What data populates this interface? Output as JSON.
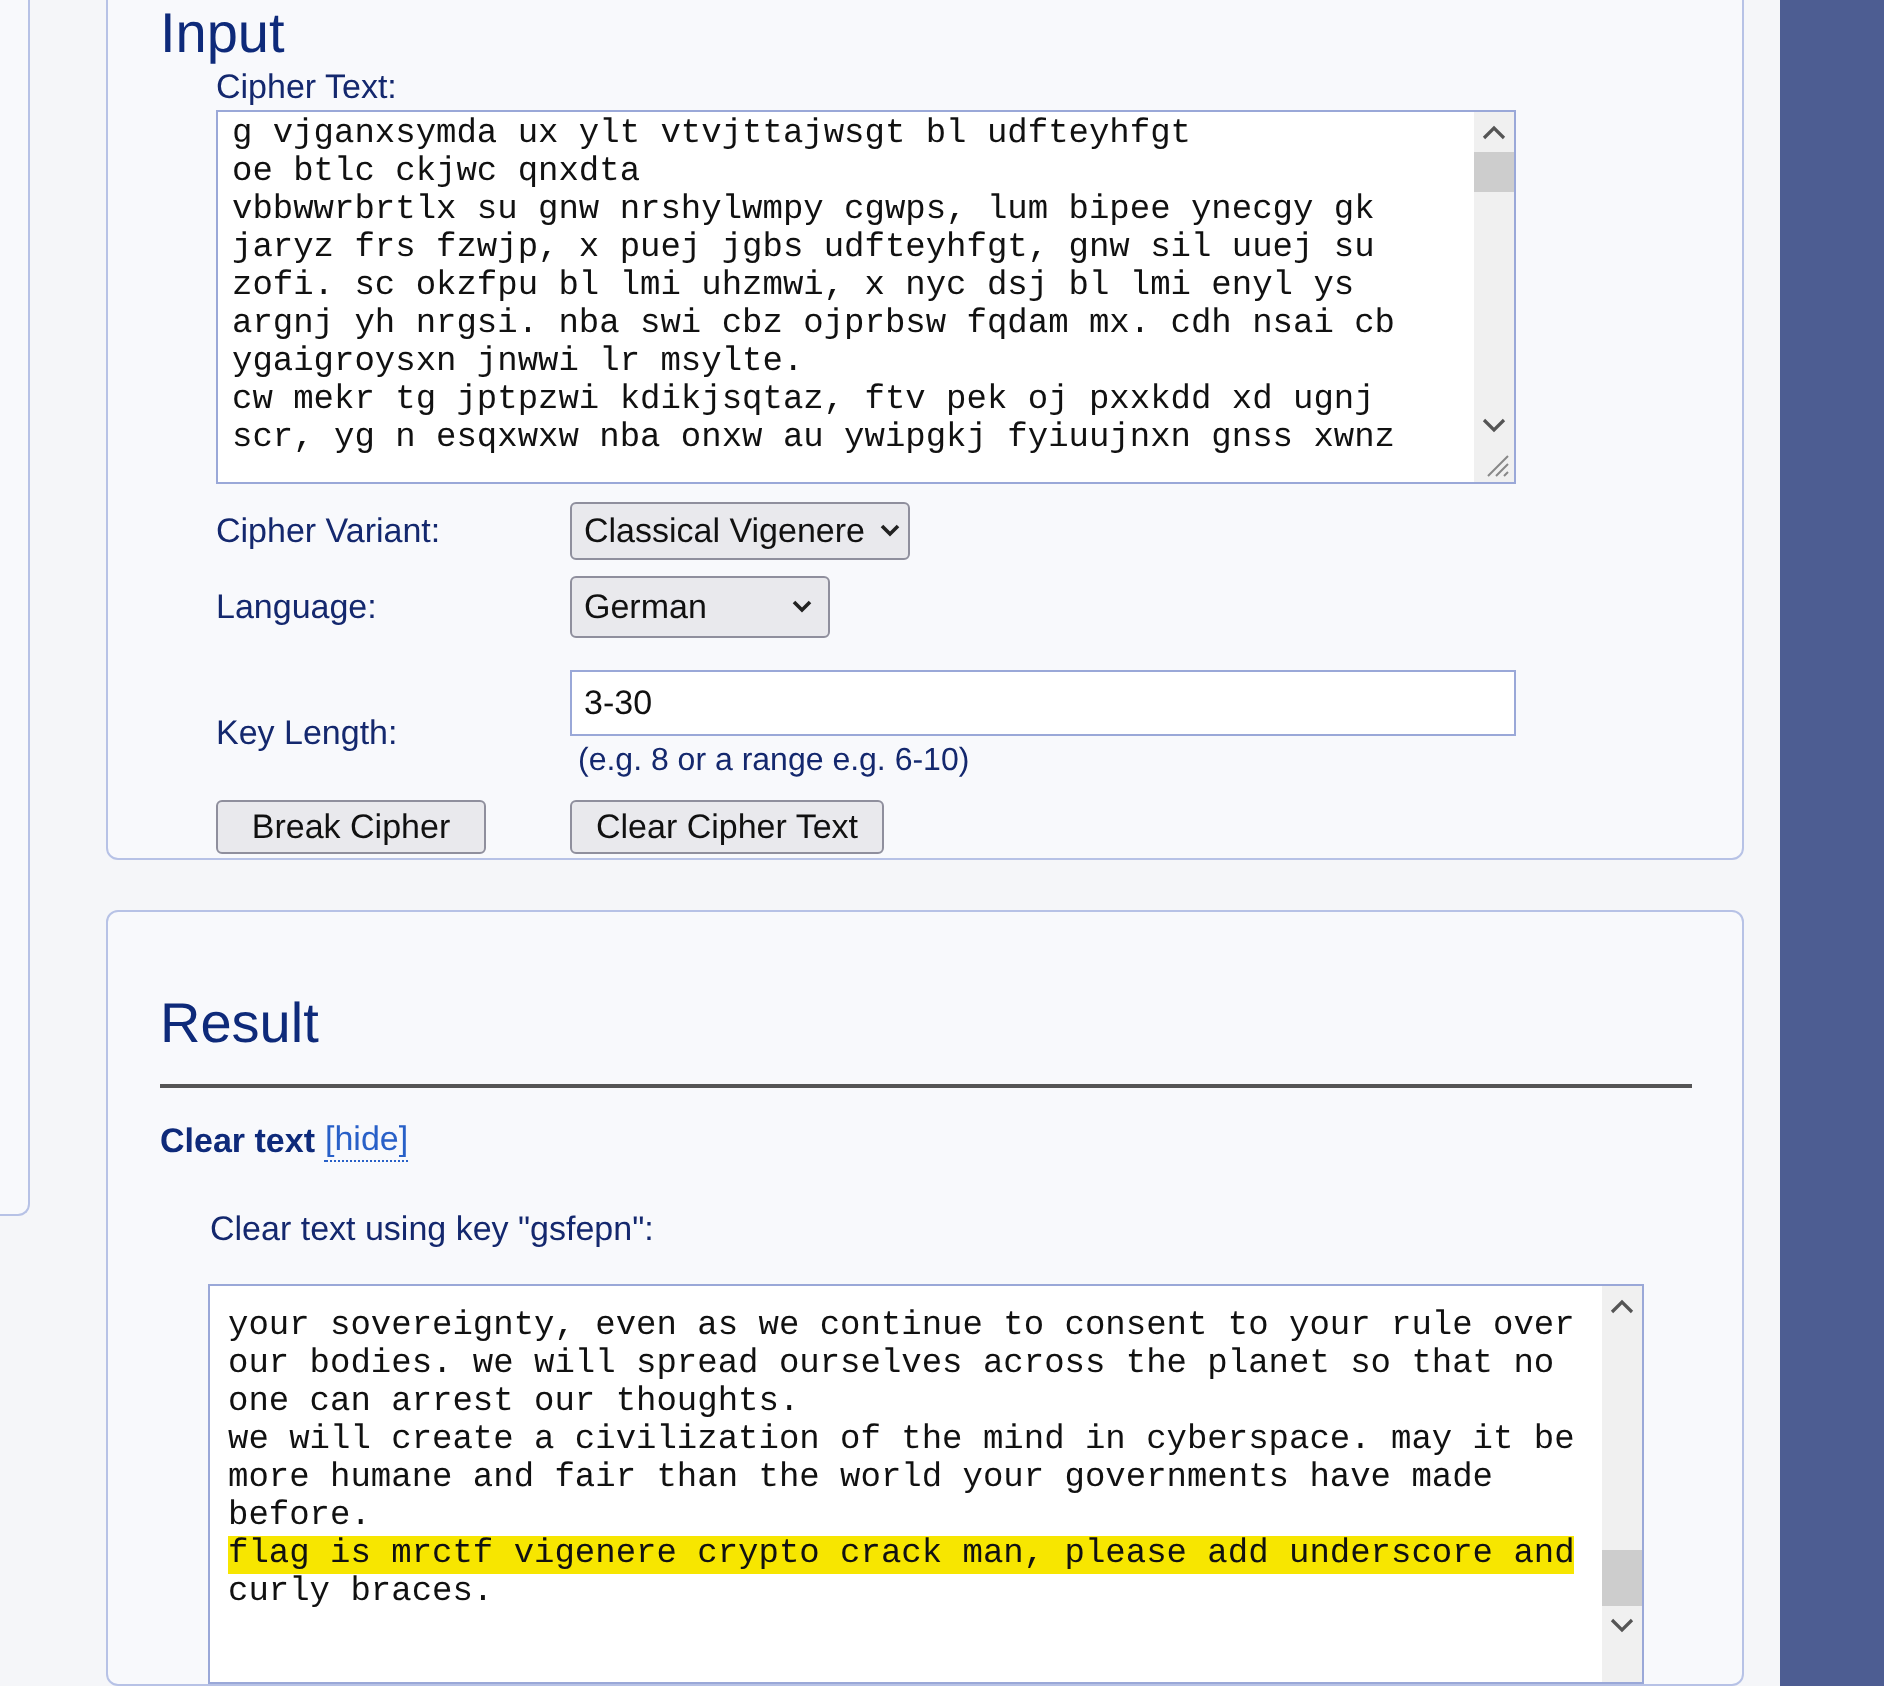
{
  "input": {
    "title": "Input",
    "cipher_label": "Cipher Text:",
    "cipher_lines": [
      "g vjganxsymda ux ylt vtvjttajwsgt bl udfteyhfgt",
      "oe btlc ckjwc qnxdta",
      "vbbwwrbrtlx su gnw nrshylwmpy cgwps, lum bipee ynecgy gk",
      "jaryz frs fzwjp, x puej jgbs udfteyhfgt, gnw sil uuej su",
      "zofi. sc okzfpu bl lmi uhzmwi, x nyc dsj bl lmi enyl ys",
      "argnj yh nrgsi. nba swi cbz ojprbsw fqdam mx. cdh nsai cb",
      "ygaigroysxn jnwwi lr msylte.",
      "cw mekr tg jptpzwi kdikjsqtaz, ftv pek oj pxxkdd xd ugnj",
      "scr, yg n esqxwxw nba onxw au ywipgkj fyiuujnxn gnss xwnz"
    ],
    "variant_label": "Cipher Variant:",
    "variant_value": "Classical Vigenere",
    "language_label": "Language:",
    "language_value": "German",
    "key_label": "Key Length:",
    "key_value": "3-30",
    "key_hint": "(e.g. 8 or a range e.g. 6-10)",
    "buttons": [
      "Break Cipher",
      "Clear Cipher Text"
    ]
  },
  "result": {
    "title": "Result",
    "subtitle": "Clear text",
    "toggle": "[hide]",
    "key_label": "Clear text using key \"gsfepn\":",
    "lines": [
      {
        "text": "your sovereignty, even as we continue to consent to your rule over",
        "highlighted": false
      },
      {
        "text": "our bodies. we will spread ourselves across the planet so that no",
        "highlighted": false
      },
      {
        "text": "one can arrest our thoughts.",
        "highlighted": false
      },
      {
        "text": "we will create a civilization of the mind in cyberspace. may it be",
        "highlighted": false
      },
      {
        "text": "more humane and fair than the world your governments have made",
        "highlighted": false
      },
      {
        "text": "before.",
        "highlighted": false
      },
      {
        "text": "flag is mrctf vigenere crypto crack man, please add underscore and",
        "highlighted": true
      },
      {
        "text": "curly braces.",
        "highlighted": false
      }
    ]
  }
}
